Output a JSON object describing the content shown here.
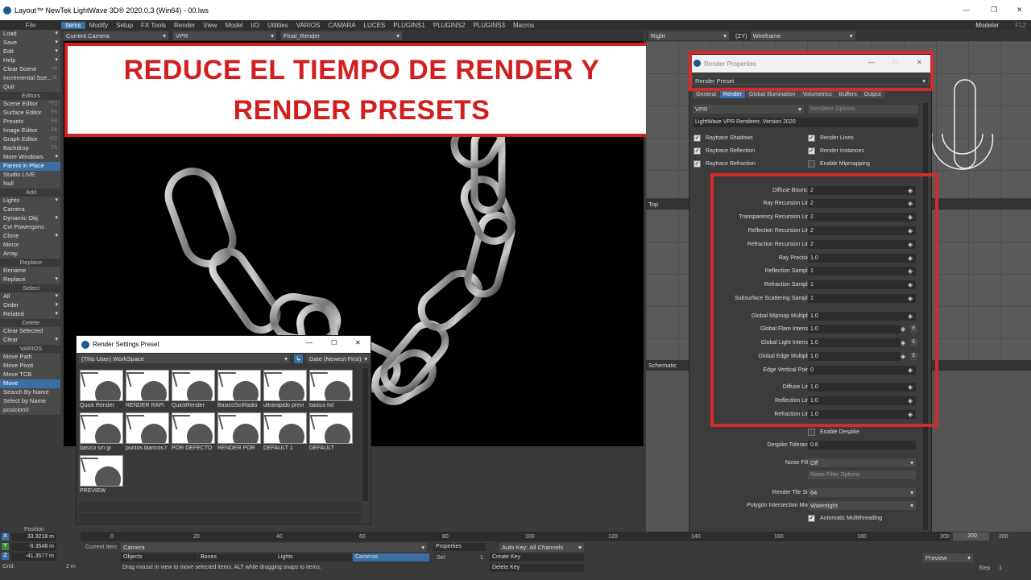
{
  "window_title": "Layout™ NewTek LightWave 3D® 2020.0.3 (Win64) - 00.lws",
  "menu": {
    "file": "File",
    "tabs": [
      "Items",
      "Modify",
      "Setup",
      "FX Tools",
      "Render",
      "View",
      "Model",
      "I/O",
      "Utilities",
      "VARIOS",
      "CAMARA",
      "LUCES",
      "PLUGINS1",
      "PLUGINS2",
      "PLUGINS3",
      "Macros"
    ],
    "active_tab": 0,
    "modeler_label": "Modeler",
    "modeler_key": "F12"
  },
  "left_panel": [
    {
      "t": "item",
      "label": "Load",
      "arrow": "▾"
    },
    {
      "t": "item",
      "label": "Save",
      "arrow": "▾"
    },
    {
      "t": "item",
      "label": "Edit",
      "arrow": "▾"
    },
    {
      "t": "item",
      "label": "Help",
      "arrow": "▾"
    },
    {
      "t": "item",
      "label": "Clear Scene",
      "shortcut": "^N"
    },
    {
      "t": "item",
      "label": "Incremental Sce...",
      "shortcut": "^S"
    },
    {
      "t": "item",
      "label": "Quit"
    },
    {
      "t": "head",
      "label": "Editors"
    },
    {
      "t": "item",
      "label": "Scene Editor",
      "shortcut": "^F1"
    },
    {
      "t": "item",
      "label": "Surface Editor",
      "shortcut": "F5"
    },
    {
      "t": "item",
      "label": "Presets",
      "shortcut": "F8"
    },
    {
      "t": "item",
      "label": "Image Editor",
      "shortcut": "F6"
    },
    {
      "t": "item",
      "label": "Graph Editor",
      "shortcut": "^F2"
    },
    {
      "t": "item",
      "label": "Backdrop",
      "shortcut": "F5"
    },
    {
      "t": "item",
      "label": "More Windows",
      "arrow": "▾"
    },
    {
      "t": "item",
      "label": "Parent in Place",
      "sel": true
    },
    {
      "t": "item",
      "label": "Studio LIVE"
    },
    {
      "t": "item",
      "label": "Null"
    },
    {
      "t": "head",
      "label": "Add"
    },
    {
      "t": "item",
      "label": "Lights",
      "arrow": "▾"
    },
    {
      "t": "item",
      "label": "Camera"
    },
    {
      "t": "item",
      "label": "Dynamic Obj",
      "arrow": "▾"
    },
    {
      "t": "item",
      "label": "Cvt Powergons"
    },
    {
      "t": "item",
      "label": "Clone",
      "arrow": "▾"
    },
    {
      "t": "item",
      "label": "Mirror"
    },
    {
      "t": "item",
      "label": "Array"
    },
    {
      "t": "head",
      "label": "Replace"
    },
    {
      "t": "item",
      "label": "Rename"
    },
    {
      "t": "item",
      "label": "Replace",
      "arrow": "▾"
    },
    {
      "t": "head",
      "label": "Select"
    },
    {
      "t": "item",
      "label": "All",
      "arrow": "▾"
    },
    {
      "t": "item",
      "label": "Order",
      "arrow": "▾"
    },
    {
      "t": "item",
      "label": "Related",
      "arrow": "▾"
    },
    {
      "t": "head",
      "label": "Delete"
    },
    {
      "t": "item",
      "label": "Clear Selected"
    },
    {
      "t": "item",
      "label": "Clear",
      "arrow": "▾"
    },
    {
      "t": "head",
      "label": "VARIOS"
    },
    {
      "t": "item",
      "label": "Move Path"
    },
    {
      "t": "item",
      "label": "Move Pivot"
    },
    {
      "t": "item",
      "label": "Move TCB"
    },
    {
      "t": "item",
      "label": "Move",
      "sel": true
    },
    {
      "t": "item",
      "label": "Search By Name"
    },
    {
      "t": "item",
      "label": "Select by Name"
    },
    {
      "t": "item",
      "label": "posicion0"
    }
  ],
  "viewport": {
    "camera": "Current Camera",
    "mode": "VPR",
    "preset": "Final_Render"
  },
  "banner": {
    "line1": "REDUCE EL TIEMPO DE RENDER Y",
    "line2": "RENDER PRESETS"
  },
  "right_viewports": {
    "top_view": "Right",
    "axes": "(ZY)",
    "shading": "Wireframe",
    "mid_view": "Top",
    "bottom_view": "Schematic"
  },
  "render_props": {
    "title": "Render Properties",
    "preset_dropdown": "Render Preset",
    "tabs": [
      "General",
      "Render",
      "Global Illumination",
      "Volumetrics",
      "Buffers",
      "Output"
    ],
    "active_tab": 1,
    "renderer": "VPR",
    "renderer_options": "Renderer Options",
    "version": "LightWave VPR Renderer, Version 2020",
    "checks_left": [
      {
        "label": "Raytrace Shadows",
        "on": true
      },
      {
        "label": "Raytrace Reflection",
        "on": true
      },
      {
        "label": "Raytrace Refraction",
        "on": true
      }
    ],
    "checks_right": [
      {
        "label": "Render Lines",
        "on": true
      },
      {
        "label": "Render Instances",
        "on": true
      },
      {
        "label": "Enable Mipmapping",
        "on": false
      }
    ],
    "fields": [
      {
        "label": "Diffuse Bounces",
        "value": "2"
      },
      {
        "label": "Ray Recursion Limit",
        "value": "2"
      },
      {
        "label": "Transparency Recursion Limit",
        "value": "2"
      },
      {
        "label": "Reflection Recursion Limit",
        "value": "2"
      },
      {
        "label": "Refraction Recursion Limit",
        "value": "2"
      },
      {
        "label": "Ray Precision",
        "value": "1.0"
      },
      {
        "label": "Reflection Samples",
        "value": "1"
      },
      {
        "label": "Refraction Samples",
        "value": "1"
      },
      {
        "label": "Subsurface Scattering Samples",
        "value": "1"
      },
      {
        "label": "Global Mipmap Multiplier",
        "value": "1.0"
      },
      {
        "label": "Global Flare Intensity",
        "value": "1.0",
        "e": "E"
      },
      {
        "label": "Global Light Intensity",
        "value": "1.0",
        "e": "E"
      },
      {
        "label": "Global Edge Multiplier",
        "value": "1.0",
        "e": "E"
      },
      {
        "label": "Edge Vertical Points",
        "value": "0"
      },
      {
        "label": "Diffuse Limit",
        "value": "1.0"
      },
      {
        "label": "Reflection Limit",
        "value": "1.0"
      },
      {
        "label": "Refraction Limit",
        "value": "1.0"
      }
    ],
    "enable_despike": "Enable Despike",
    "despike_label": "Despike Tolerance",
    "despike_value": "0.8",
    "noise_label": "Noise Filter",
    "noise_value": "Off",
    "noise_options": "Noise Filter Options",
    "tile_label": "Render Tile Size",
    "tile_value": "64",
    "poly_label": "Polygon Intersection Mode",
    "poly_value": "Watertight",
    "auto_mt": "Automatic Multithreading"
  },
  "preset_window": {
    "title": "Render Settings Preset",
    "source": "(This User) WorkSpace",
    "sort": "Date (Newest First)",
    "items": [
      "Quick Render",
      "RENDER RAPI",
      "QuickRender",
      "BasicoSinRadio",
      "ultrarapido previ",
      "basico hd",
      "basico sin gi",
      "puntos blancos r",
      "POR DEFECTO",
      "RENDER POR",
      "DEFAULT 1",
      "DEFAULT",
      "PREVIEW"
    ]
  },
  "bottom": {
    "position_label": "Position",
    "x": "33.3218 m",
    "y": "-9.3548 m",
    "z": "-41.3577 m",
    "grid_label": "Grid:",
    "grid_value": "2 m",
    "current_item_label": "Current Item",
    "current_item": "Camera",
    "ticks": [
      "0",
      "20",
      "40",
      "60",
      "80",
      "100",
      "120",
      "140",
      "160",
      "180",
      "200"
    ],
    "frame_start": "0",
    "frame_current": "200",
    "frame_end": "200",
    "objects": "Objects",
    "bones": "Bones",
    "lights": "Lights",
    "cameras": "Cameras",
    "properties": "Properties",
    "sel_label": "Sel:",
    "sel_value": "1",
    "autokey": "Auto Key: All Channels",
    "create_key": "Create Key",
    "delete_key": "Delete Key",
    "status": "Drag mouse in view to move selected items. ALT while dragging snaps to items.",
    "preview": "Preview",
    "step_label": "Step",
    "step_value": "1"
  }
}
